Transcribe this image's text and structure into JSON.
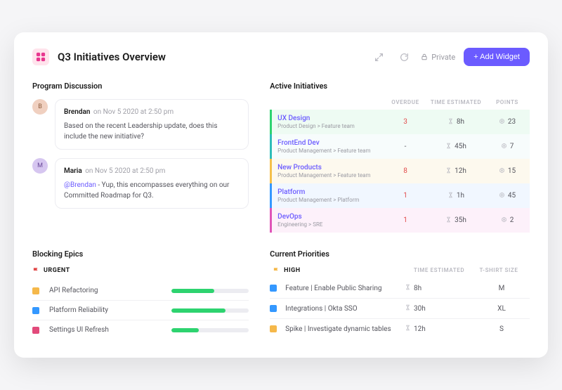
{
  "header": {
    "title": "Q3 Initiatives Overview",
    "private_label": "Private",
    "add_widget_label": "+ Add Widget"
  },
  "discussion": {
    "title": "Program Discussion",
    "comments": [
      {
        "author": "Brendan",
        "meta": "on Nov 5 2020 at 2:50 pm",
        "body": "Based on the recent Leadership update, does this include the new initiative?"
      },
      {
        "author": "Maria",
        "meta": "on Nov 5 2020 at 2:50 pm",
        "mention": "@Brendan",
        "body": " - Yup, this encompasses everything on our Committed Roadmap for Q3."
      }
    ]
  },
  "initiatives": {
    "title": "Active Initiatives",
    "cols": {
      "overdue": "OVERDUE",
      "time": "TIME ESTIMATED",
      "points": "POINTS"
    },
    "rows": [
      {
        "name": "UX Design",
        "crumb": "Product Design > Feature team",
        "overdue": "3",
        "overdue_red": true,
        "time": "8h",
        "points": "23"
      },
      {
        "name": "FrontEnd Dev",
        "crumb": "Product Management > Feature team",
        "overdue": "-",
        "overdue_red": false,
        "time": "45h",
        "points": "7"
      },
      {
        "name": "New Products",
        "crumb": "Product Management > Feature team",
        "overdue": "8",
        "overdue_red": true,
        "time": "12h",
        "points": "15"
      },
      {
        "name": "Platform",
        "crumb": "Product Management > Platform",
        "overdue": "1",
        "overdue_red": true,
        "time": "1h",
        "points": "45"
      },
      {
        "name": "DevOps",
        "crumb": "Engineering > SRE",
        "overdue": "1",
        "overdue_red": true,
        "time": "35h",
        "points": "2"
      }
    ]
  },
  "epics": {
    "title": "Blocking Epics",
    "flag": "URGENT",
    "rows": [
      {
        "name": "API Refactoring",
        "color": "#f5b84a",
        "pct": 55
      },
      {
        "name": "Platform Reliability",
        "color": "#3498ff",
        "pct": 70
      },
      {
        "name": "Settings UI Refresh",
        "color": "#e24a7b",
        "pct": 35
      }
    ]
  },
  "priorities": {
    "title": "Current Priorities",
    "flag": "HIGH",
    "cols": {
      "time": "TIME ESTIMATED",
      "size": "T-SHIRT SIZE"
    },
    "rows": [
      {
        "name": "Feature | Enable Public Sharing",
        "color": "#3498ff",
        "time": "8h",
        "size": "M"
      },
      {
        "name": "Integrations | Okta SSO",
        "color": "#3498ff",
        "time": "30h",
        "size": "XL"
      },
      {
        "name": "Spike | Investigate dynamic tables",
        "color": "#f5b84a",
        "time": "12h",
        "size": "S"
      }
    ]
  }
}
